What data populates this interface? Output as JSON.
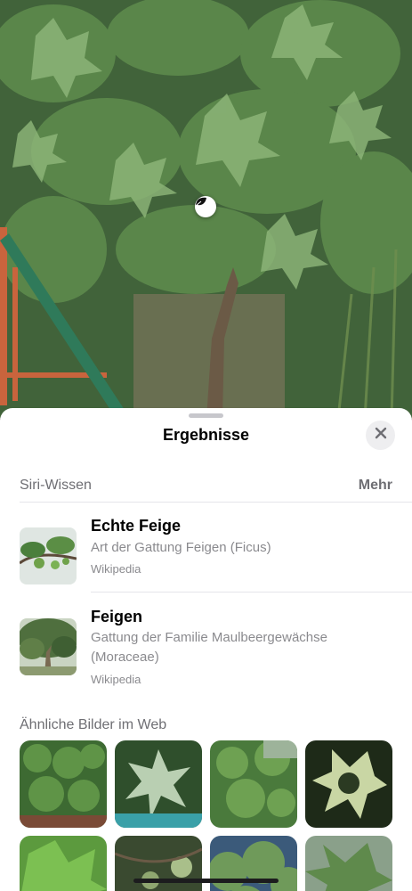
{
  "sheet": {
    "title": "Ergebnisse",
    "close_icon": "xmark-icon"
  },
  "siri_knowledge": {
    "header": "Siri-Wissen",
    "more_label": "Mehr",
    "results": [
      {
        "title": "Echte Feige",
        "subtitle": "Art der Gattung Feigen (Ficus)",
        "source": "Wikipedia"
      },
      {
        "title": "Feigen",
        "subtitle_line1": "Gattung der Familie Maulbeergewächse",
        "subtitle_line2": "(Moraceae)",
        "source": "Wikipedia"
      }
    ]
  },
  "similar_images": {
    "header": "Ähnliche Bilder im Web",
    "count_visible": 8
  },
  "colors": {
    "accent_gray": "#6e6e73",
    "sheet_bg": "#ffffff",
    "leaf_green": "#4f7a3f"
  },
  "icons": {
    "visual_lookup": "leaf-icon"
  }
}
